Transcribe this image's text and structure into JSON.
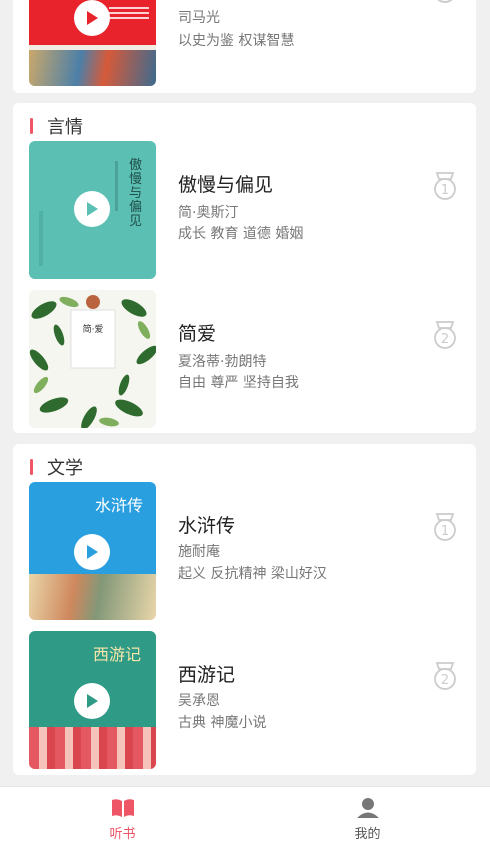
{
  "sections": [
    {
      "title": "",
      "books": [
        {
          "title": "",
          "author": "司马光",
          "tags": "以史为鉴 权谋智慧",
          "rank": ""
        }
      ]
    },
    {
      "title": "言情",
      "books": [
        {
          "title": "傲慢与偏见",
          "author": "简·奥斯汀",
          "tags": "成长 教育 道德 婚姻",
          "rank": "1",
          "cover_text": "傲慢与偏见"
        },
        {
          "title": "简爱",
          "author": "夏洛蒂·勃朗特",
          "tags": "自由 尊严 坚持自我",
          "rank": "2",
          "cover_text": "简·爱"
        }
      ]
    },
    {
      "title": "文学",
      "books": [
        {
          "title": "水浒传",
          "author": "施耐庵",
          "tags": "起义 反抗精神 梁山好汉",
          "rank": "1",
          "cover_text": "水浒传"
        },
        {
          "title": "西游记",
          "author": "吴承恩",
          "tags": "古典 神魔小说",
          "rank": "2",
          "cover_text": "西游记"
        }
      ]
    }
  ],
  "tabbar": {
    "items": [
      {
        "label": "听书",
        "icon": "book-icon",
        "active": true,
        "color": "#ee5566"
      },
      {
        "label": "我的",
        "icon": "user-icon",
        "active": false,
        "color": "#666666"
      }
    ]
  },
  "colors": {
    "accent": "#ee5566",
    "background": "#f0f0f0",
    "card": "#ffffff"
  }
}
